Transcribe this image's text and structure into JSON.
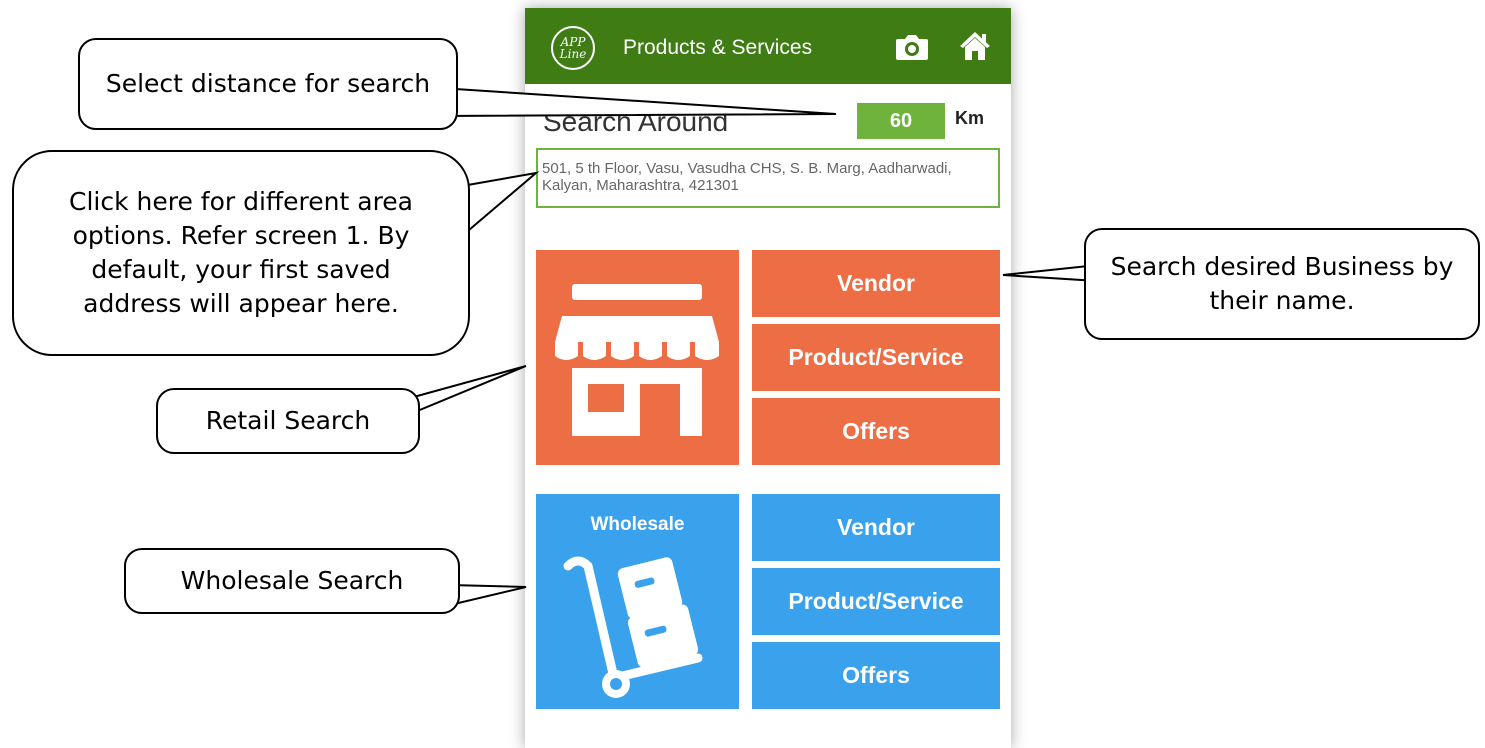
{
  "app": {
    "logo_text": "APP Line",
    "title": "Products & Services"
  },
  "icons": {
    "camera": "camera-icon",
    "home": "home-icon",
    "store": "store-icon",
    "trolley": "hand-truck-icon"
  },
  "colors": {
    "appbar": "#3f7d14",
    "accent_green": "#6fb33c",
    "retail": "#ed6d45",
    "wholesale": "#3aa2ec"
  },
  "search": {
    "label": "Search Around",
    "distance_value": "60",
    "distance_unit": "Km",
    "address": "501, 5 th Floor, Vasu, Vasudha CHS, S. B. Marg, Aadharwadi, Kalyan, Maharashtra, 421301"
  },
  "retail": {
    "buttons": [
      "Vendor",
      "Product/Service",
      "Offers"
    ]
  },
  "wholesale": {
    "label": "Wholesale",
    "buttons": [
      "Vendor",
      "Product/Service",
      "Offers"
    ]
  },
  "callouts": {
    "distance": "Select distance for search",
    "area": "Click here for different area options. Refer screen 1. By default, your first saved address will appear here.",
    "vendor": "Search desired Business by their name.",
    "retail": "Retail Search",
    "wholesale": "Wholesale Search"
  }
}
